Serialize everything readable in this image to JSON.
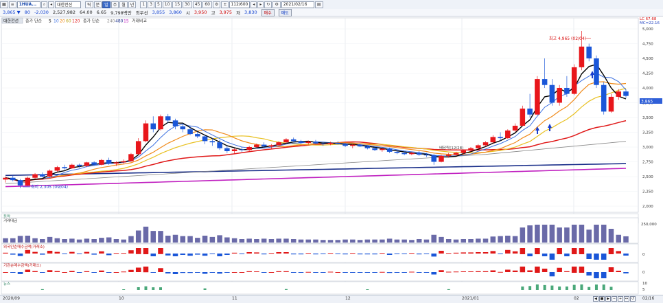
{
  "toolbar": {
    "code": "1HUA...",
    "stock_name": "대한전선",
    "periods": [
      "틱",
      "분",
      "일",
      "주",
      "월",
      "년"
    ],
    "minutes": [
      "1",
      "3",
      "5",
      "10",
      "15",
      "30",
      "45",
      "60"
    ],
    "count": "112/600",
    "date": "2021/02/16"
  },
  "quote": {
    "price": "3,865",
    "change": "80",
    "change_pct": "-2.030",
    "volume": "2,527,982",
    "vol_ratio": "64.00",
    "rate": "6.65",
    "amount": "9,798백만",
    "label_prev": "최우선",
    "best": "3,855",
    "best2": "3,860",
    "open_label": "시",
    "open": "3,950",
    "high_label": "고",
    "high": "3,975",
    "low_label": "저",
    "low": "3,830",
    "buy": "매수",
    "sell": "매도"
  },
  "legend": {
    "stock": "대한전선",
    "ma_label": "종가 단순",
    "ma_periods": [
      "5",
      "10",
      "20",
      "60",
      "120"
    ],
    "ma2_label": "종가 단순",
    "ma2_periods": [
      "240",
      "480",
      "15"
    ],
    "vol_label": "거래비교"
  },
  "annotations": {
    "high": "최고 4,965 (02/04)",
    "low": "최저 2,305 (09/04)",
    "mid": "배당락(12/28)"
  },
  "panels": {
    "p1": "등락",
    "p2": "거래대금",
    "p3": "외국인순매수금액(거래소)",
    "p4": "기관순매수금액(거래소)",
    "p5": "뉴스"
  },
  "right_axis": {
    "price_ticks": [
      "5,000",
      "4,750",
      "4,500",
      "4,250",
      "4,000",
      "3,750",
      "3,500",
      "3,250",
      "3,000",
      "2,750",
      "2,500",
      "2,250",
      "2,000"
    ],
    "current": "3,865",
    "top_label1": "LC 67.68",
    "top_label2": "MC=22.16",
    "vol_tick": "250,000",
    "zero": "0",
    "zero2": "0",
    "news_ticks": [
      "10",
      "5"
    ]
  },
  "x_axis": [
    "2020/09",
    "10",
    "11",
    "12",
    "2021/01",
    "02",
    "02/16"
  ],
  "colors": {
    "up": "#e8161b",
    "down": "#1a56d8",
    "ma5": "#000000",
    "ma10": "#3b6fe0",
    "ma20": "#f08a1a",
    "ma60": "#e8c020",
    "ma120": "#e01818",
    "ma240": "#888888",
    "ma480": "#1a2f8a",
    "maL": "#c020c0"
  },
  "chart_data": {
    "type": "candlestick",
    "x_range": [
      "2020/09",
      "2021/02/16"
    ],
    "y_range": [
      2000,
      5000
    ],
    "candles": [
      [
        2450,
        2500,
        2400,
        2480
      ],
      [
        2480,
        2520,
        2420,
        2440
      ],
      [
        2440,
        2460,
        2305,
        2350
      ],
      [
        2350,
        2500,
        2340,
        2480
      ],
      [
        2480,
        2560,
        2460,
        2540
      ],
      [
        2540,
        2570,
        2490,
        2500
      ],
      [
        2500,
        2620,
        2490,
        2600
      ],
      [
        2600,
        2680,
        2580,
        2660
      ],
      [
        2660,
        2700,
        2620,
        2640
      ],
      [
        2640,
        2720,
        2630,
        2700
      ],
      [
        2700,
        2720,
        2650,
        2680
      ],
      [
        2680,
        2750,
        2660,
        2740
      ],
      [
        2740,
        2760,
        2680,
        2700
      ],
      [
        2700,
        2800,
        2690,
        2780
      ],
      [
        2780,
        2820,
        2700,
        2720
      ],
      [
        2720,
        2760,
        2680,
        2740
      ],
      [
        2740,
        2790,
        2720,
        2760
      ],
      [
        2760,
        2900,
        2750,
        2880
      ],
      [
        2880,
        3150,
        2870,
        3100
      ],
      [
        3100,
        3450,
        3080,
        3400
      ],
      [
        3400,
        3520,
        3250,
        3300
      ],
      [
        3300,
        3550,
        3280,
        3520
      ],
      [
        3520,
        3560,
        3400,
        3450
      ],
      [
        3450,
        3480,
        3300,
        3350
      ],
      [
        3350,
        3400,
        3250,
        3300
      ],
      [
        3300,
        3350,
        3200,
        3220
      ],
      [
        3220,
        3260,
        3150,
        3180
      ],
      [
        3180,
        3210,
        3050,
        3100
      ],
      [
        3100,
        3150,
        3020,
        3080
      ],
      [
        3080,
        3120,
        2950,
        2980
      ],
      [
        2980,
        3020,
        2900,
        2930
      ],
      [
        2930,
        2980,
        2880,
        2960
      ],
      [
        2960,
        3000,
        2920,
        2950
      ],
      [
        2950,
        3020,
        2930,
        3000
      ],
      [
        3000,
        3060,
        2980,
        3040
      ],
      [
        3040,
        3080,
        2990,
        3010
      ],
      [
        3010,
        3050,
        2970,
        3030
      ],
      [
        3030,
        3100,
        3010,
        3080
      ],
      [
        3080,
        3150,
        3060,
        3130
      ],
      [
        3130,
        3160,
        3080,
        3100
      ],
      [
        3100,
        3120,
        3050,
        3070
      ],
      [
        3070,
        3110,
        3040,
        3090
      ],
      [
        3090,
        3120,
        3050,
        3060
      ],
      [
        3060,
        3080,
        3020,
        3050
      ],
      [
        3050,
        3090,
        3030,
        3070
      ],
      [
        3070,
        3100,
        3040,
        3050
      ],
      [
        3050,
        3070,
        3000,
        3020
      ],
      [
        3020,
        3050,
        2980,
        3040
      ],
      [
        3040,
        3060,
        3000,
        3010
      ],
      [
        3010,
        3030,
        2960,
        2980
      ],
      [
        2980,
        3000,
        2930,
        2950
      ],
      [
        2950,
        2990,
        2920,
        2970
      ],
      [
        2970,
        2990,
        2900,
        2920
      ],
      [
        2920,
        2950,
        2880,
        2900
      ],
      [
        2900,
        2930,
        2860,
        2880
      ],
      [
        2880,
        2920,
        2860,
        2900
      ],
      [
        2900,
        2930,
        2850,
        2870
      ],
      [
        2870,
        2900,
        2830,
        2860
      ],
      [
        2860,
        2880,
        2700,
        2750
      ],
      [
        2750,
        2870,
        2740,
        2850
      ],
      [
        2850,
        2900,
        2820,
        2870
      ],
      [
        2870,
        2920,
        2850,
        2900
      ],
      [
        2900,
        2960,
        2880,
        2940
      ],
      [
        2940,
        3000,
        2920,
        2980
      ],
      [
        2980,
        3050,
        2960,
        3030
      ],
      [
        3030,
        3100,
        3010,
        3080
      ],
      [
        3080,
        3200,
        3060,
        3170
      ],
      [
        3170,
        3250,
        3100,
        3150
      ],
      [
        3150,
        3300,
        3140,
        3280
      ],
      [
        3280,
        3400,
        3250,
        3360
      ],
      [
        3360,
        3700,
        3350,
        3650
      ],
      [
        3650,
        3900,
        3500,
        3550
      ],
      [
        3550,
        4200,
        3540,
        4150
      ],
      [
        4150,
        4500,
        4000,
        4050
      ],
      [
        4050,
        4150,
        3700,
        3750
      ],
      [
        3750,
        4050,
        3700,
        4000
      ],
      [
        4000,
        4200,
        3850,
        3900
      ],
      [
        3900,
        4400,
        3880,
        4350
      ],
      [
        4350,
        4965,
        4300,
        4700
      ],
      [
        4700,
        4750,
        4450,
        4500
      ],
      [
        4500,
        4550,
        4000,
        4050
      ],
      [
        4050,
        4100,
        3550,
        3600
      ],
      [
        3600,
        3900,
        3580,
        3850
      ],
      [
        3850,
        3980,
        3800,
        3940
      ],
      [
        3940,
        3975,
        3830,
        3865
      ]
    ]
  }
}
